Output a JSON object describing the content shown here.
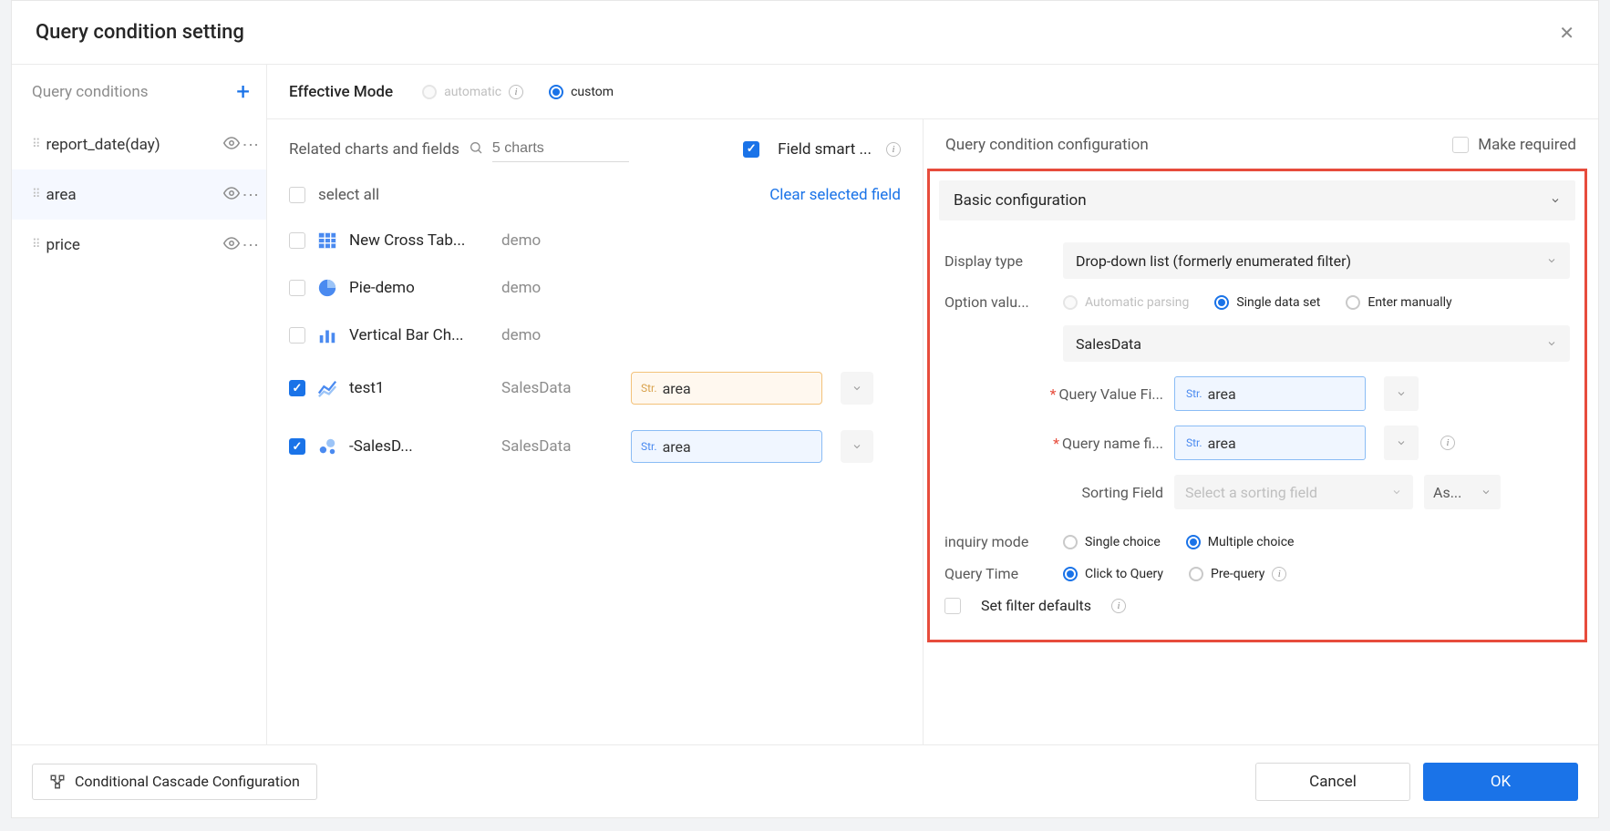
{
  "header": {
    "title": "Query condition setting"
  },
  "sidebar": {
    "head": "Query conditions",
    "items": [
      {
        "label": "report_date(day)",
        "active": false
      },
      {
        "label": "area",
        "active": true
      },
      {
        "label": "price",
        "active": false
      }
    ]
  },
  "effective": {
    "label": "Effective Mode",
    "automatic": "automatic",
    "custom": "custom",
    "selected": "custom"
  },
  "related": {
    "label": "Related charts and fields",
    "search_placeholder": "5 charts",
    "field_smart": "Field smart ...",
    "select_all": "select all",
    "clear": "Clear selected field",
    "charts": [
      {
        "icon": "table",
        "name": "New Cross Tab...",
        "ds": "demo",
        "checked": false,
        "field": null
      },
      {
        "icon": "pie",
        "name": "Pie-demo",
        "ds": "demo",
        "checked": false,
        "field": null
      },
      {
        "icon": "bar",
        "name": "Vertical Bar Ch...",
        "ds": "demo",
        "checked": false,
        "field": null
      },
      {
        "icon": "line",
        "name": "        test1",
        "ds": "SalesData",
        "checked": true,
        "field": "area",
        "field_style": "orange"
      },
      {
        "icon": "bubble",
        "name": "        -SalesD...",
        "ds": "SalesData",
        "checked": true,
        "field": "area",
        "field_style": "blue"
      }
    ]
  },
  "config": {
    "head": "Query condition configuration",
    "make_required": "Make required",
    "basic_title": "Basic configuration",
    "display_type": {
      "label": "Display type",
      "value": "Drop-down list (formerly enumerated filter)"
    },
    "option_value": {
      "label": "Option valu...",
      "options": {
        "auto": "Automatic parsing",
        "single": "Single data set",
        "manual": "Enter manually"
      },
      "selected": "single"
    },
    "dataset": "SalesData",
    "query_value": {
      "label": "Query Value Fi...",
      "value": "area"
    },
    "query_name": {
      "label": "Query name fi...",
      "value": "area"
    },
    "sorting": {
      "label": "Sorting Field",
      "placeholder": "Select a sorting field",
      "order": "As..."
    },
    "inquiry_mode": {
      "label": "inquiry mode",
      "single": "Single choice",
      "multiple": "Multiple choice",
      "selected": "multiple"
    },
    "query_time": {
      "label": "Query Time",
      "click": "Click to Query",
      "pre": "Pre-query",
      "selected": "click"
    },
    "set_defaults": "Set filter defaults"
  },
  "footer": {
    "cascade": "Conditional Cascade Configuration",
    "cancel": "Cancel",
    "ok": "OK"
  },
  "type_prefix": "Str."
}
